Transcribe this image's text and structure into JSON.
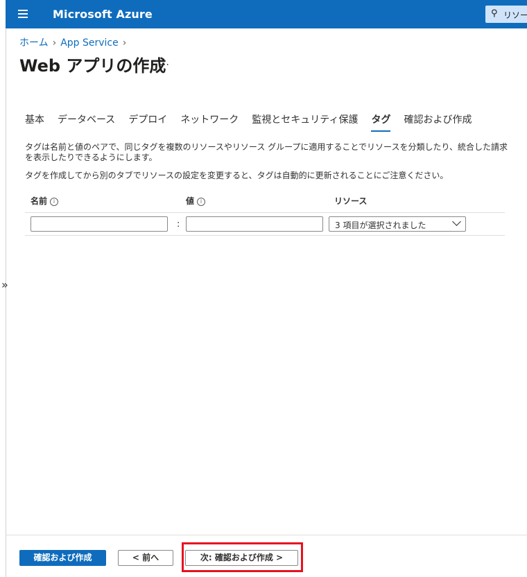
{
  "app": {
    "brand": "Microsoft Azure",
    "search_placeholder": "リソー"
  },
  "breadcrumb": {
    "home": "ホーム",
    "service": "App Service"
  },
  "page": {
    "title": "Web アプリの作成",
    "more": "…"
  },
  "tabs": [
    {
      "label": "基本"
    },
    {
      "label": "データベース"
    },
    {
      "label": "デプロイ"
    },
    {
      "label": "ネットワーク"
    },
    {
      "label": "監視とセキュリティ保護"
    },
    {
      "label": "タグ",
      "active": true
    },
    {
      "label": "確認および作成"
    }
  ],
  "description": {
    "line1": "タグは名前と値のペアで、同じタグを複数のリソースやリソース グループに適用することでリソースを分類したり、統合した請求を表示したりできるようにします。",
    "line2": "タグを作成してから別のタブでリソースの設定を変更すると、タグは自動的に更新されることにご注意ください。"
  },
  "table": {
    "headers": {
      "name": "名前",
      "value": "値",
      "resource": "リソース"
    },
    "separator": ":",
    "row": {
      "name_value": "",
      "value_value": "",
      "resource_selected": "3 項目が選択されました"
    }
  },
  "footer": {
    "review_create": "確認および作成",
    "prev": "< 前へ",
    "next": "次: 確認および作成 >"
  },
  "colors": {
    "accent": "#0f6cbd",
    "highlight": "#e8101f"
  },
  "icons": {
    "hamburger": "hamburger-icon",
    "search": "search-icon",
    "info": "info-icon",
    "chevron": "chevron-down-icon",
    "expand": "double-chevron-right-icon"
  }
}
